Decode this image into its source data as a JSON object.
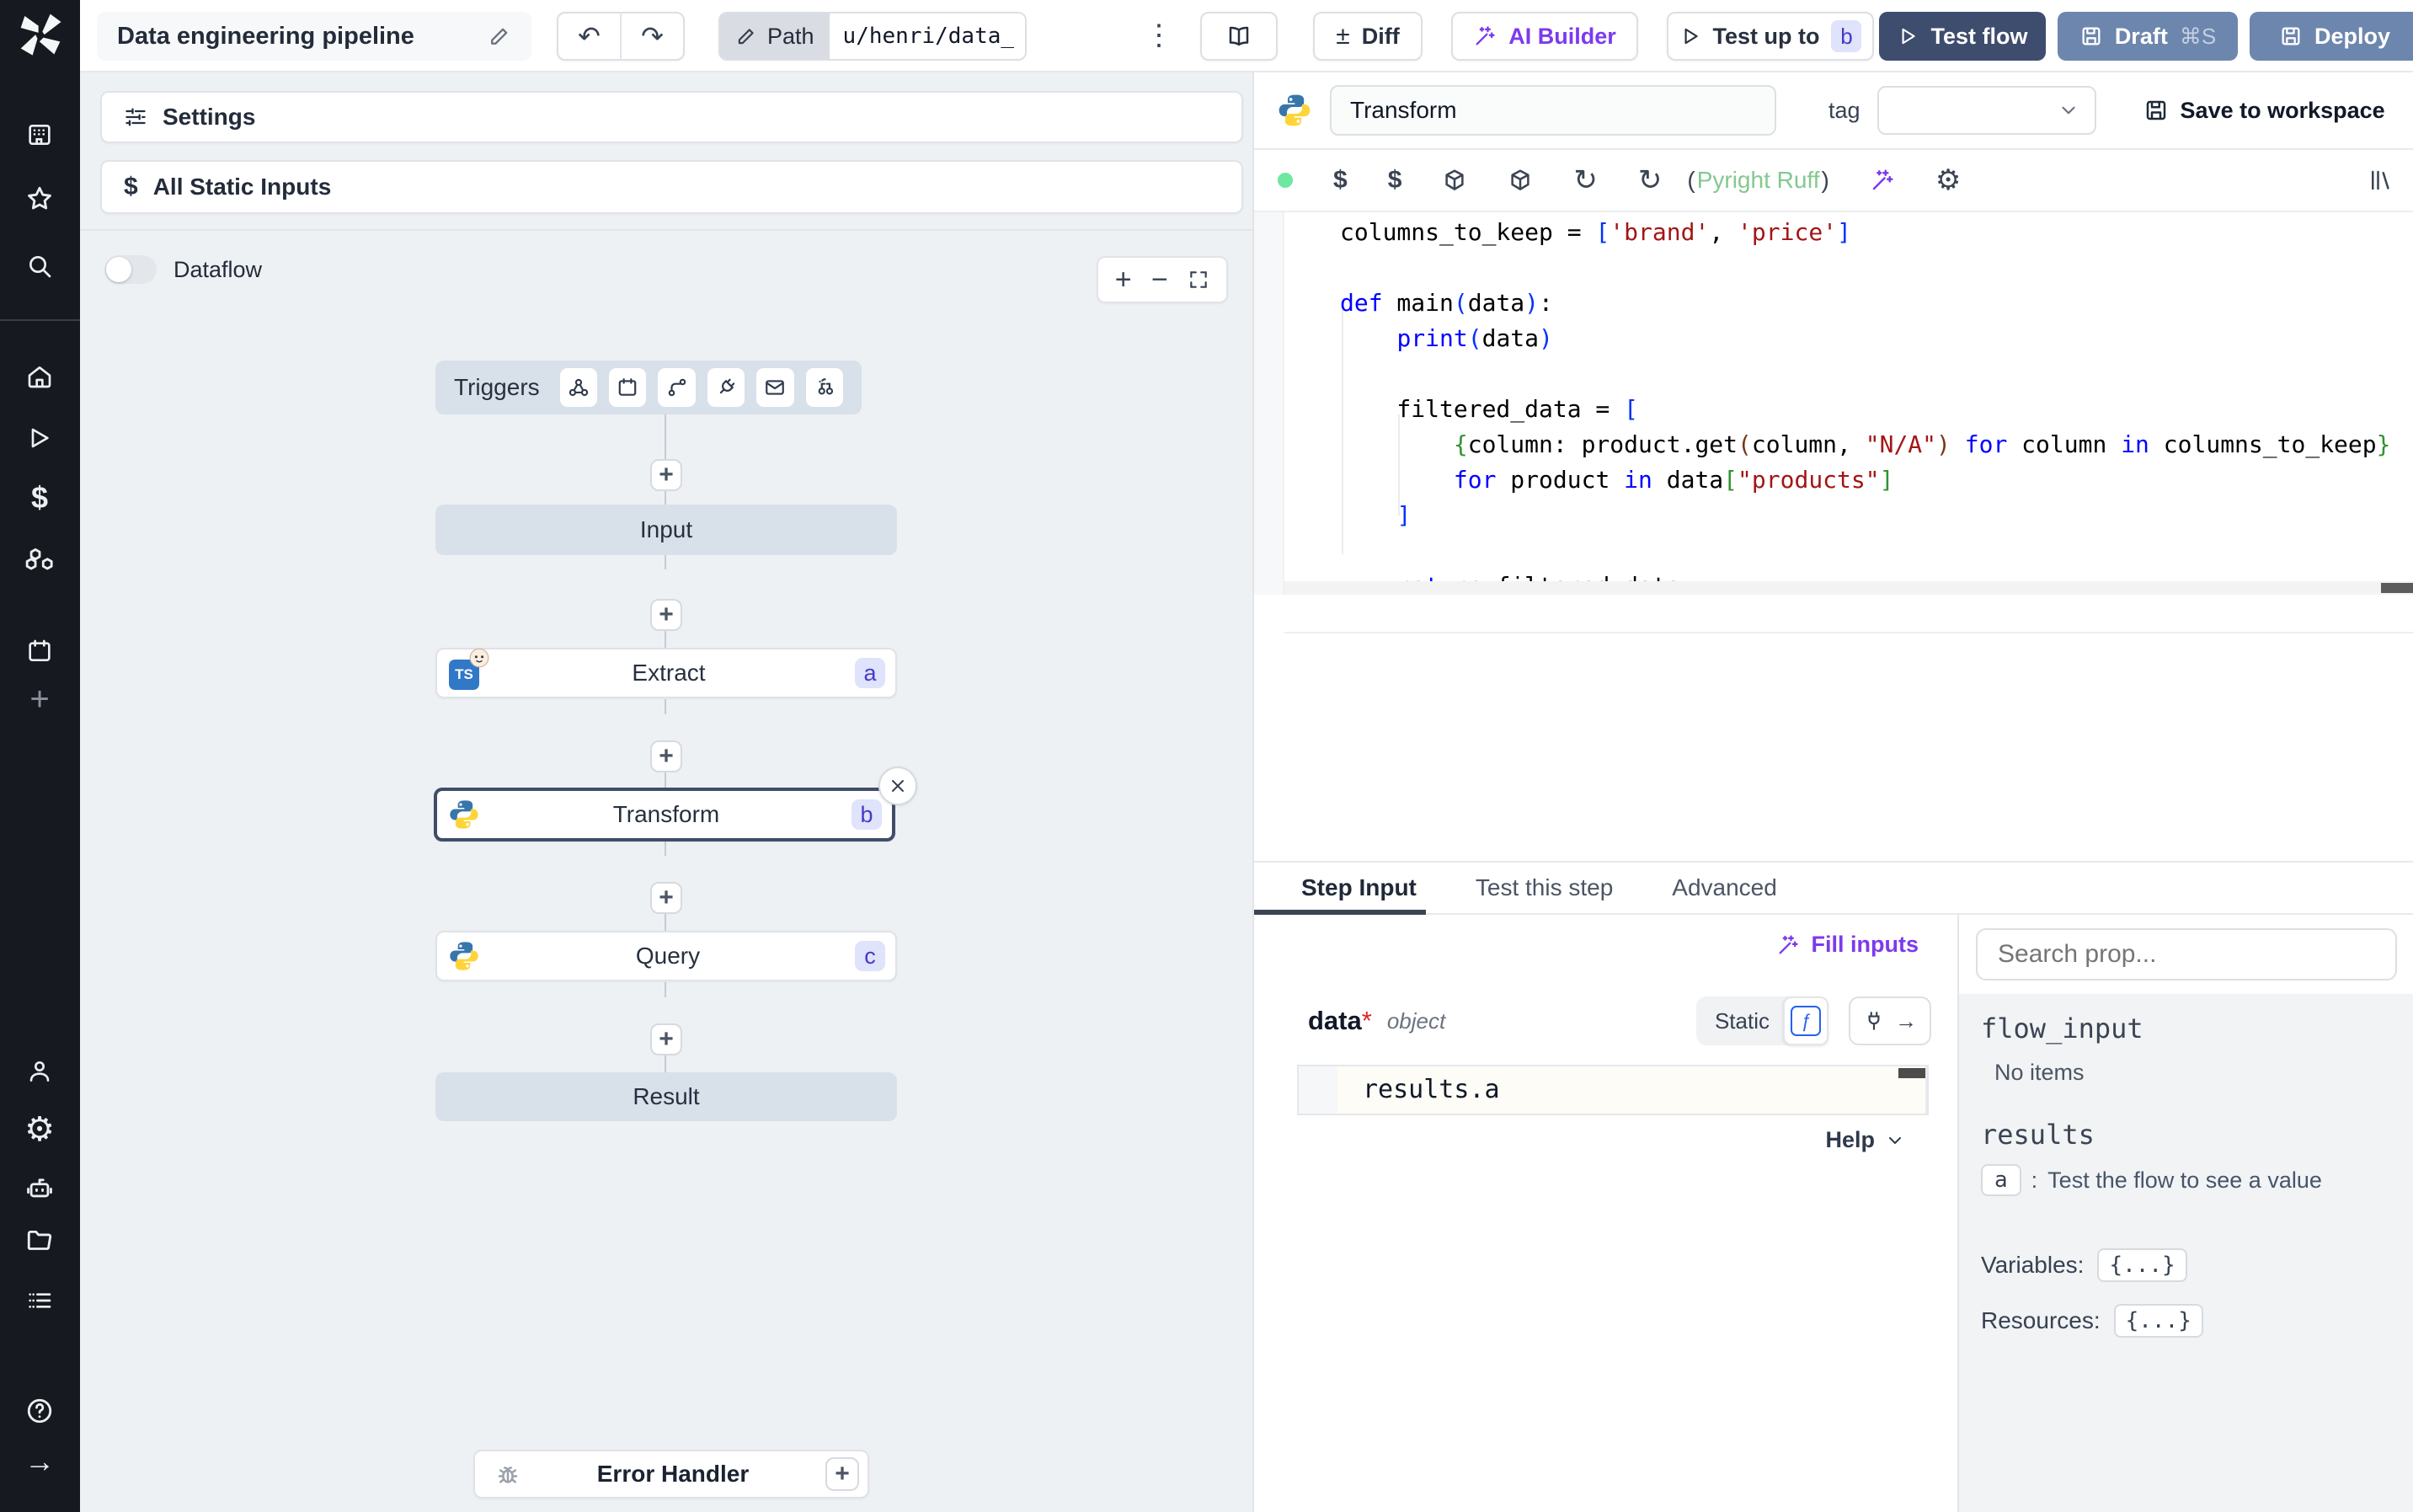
{
  "topbar": {
    "title": "Data engineering pipeline",
    "path_label": "Path",
    "path_value": "u/henri/data_",
    "diff_label": "Diff",
    "ai_builder_label": "AI Builder",
    "test_up_to_label": "Test up to",
    "test_up_to_badge": "b",
    "test_flow_label": "Test flow",
    "draft_label": "Draft",
    "draft_shortcut": "⌘S",
    "deploy_label": "Deploy"
  },
  "flow_panel": {
    "settings_label": "Settings",
    "static_inputs_label": "All Static Inputs",
    "dataflow_label": "Dataflow",
    "triggers_label": "Triggers",
    "nodes": {
      "input": {
        "label": "Input"
      },
      "extract": {
        "label": "Extract",
        "badge": "a",
        "lang": "TS"
      },
      "transform": {
        "label": "Transform",
        "badge": "b"
      },
      "query": {
        "label": "Query",
        "badge": "c"
      },
      "result": {
        "label": "Result"
      }
    },
    "error_handler_label": "Error Handler"
  },
  "editor": {
    "step_name": "Transform",
    "tag_label": "tag",
    "save_label": "Save to workspace",
    "diag_open": "(",
    "diag_text": "Pyright Ruff",
    "diag_close": ")",
    "code_lines": [
      [
        [
          "p",
          "columns_to_keep = "
        ],
        [
          "b",
          "["
        ],
        [
          "s",
          "'brand'"
        ],
        [
          "p",
          ", "
        ],
        [
          "s",
          "'price'"
        ],
        [
          "b",
          "]"
        ]
      ],
      [],
      [
        [
          "k",
          "def"
        ],
        [
          "p",
          " main"
        ],
        [
          "b",
          "("
        ],
        [
          "p",
          "data"
        ],
        [
          "b",
          ")"
        ],
        [
          "p",
          ":"
        ]
      ],
      [
        [
          "p",
          "    "
        ],
        [
          "k",
          "print"
        ],
        [
          "b",
          "("
        ],
        [
          "p",
          "data"
        ],
        [
          "b",
          ")"
        ]
      ],
      [],
      [
        [
          "p",
          "    filtered_data = "
        ],
        [
          "b",
          "["
        ]
      ],
      [
        [
          "p",
          "        "
        ],
        [
          "g",
          "{"
        ],
        [
          "p",
          "column: product.get"
        ],
        [
          "o",
          "("
        ],
        [
          "p",
          "column, "
        ],
        [
          "s",
          "\"N/A\""
        ],
        [
          "o",
          ")"
        ],
        [
          "p",
          " "
        ],
        [
          "k",
          "for"
        ],
        [
          "p",
          " column "
        ],
        [
          "k",
          "in"
        ],
        [
          "p",
          " columns_to_keep"
        ],
        [
          "g",
          "}"
        ]
      ],
      [
        [
          "p",
          "        "
        ],
        [
          "k",
          "for"
        ],
        [
          "p",
          " product "
        ],
        [
          "k",
          "in"
        ],
        [
          "p",
          " data"
        ],
        [
          "g",
          "["
        ],
        [
          "s",
          "\"products\""
        ],
        [
          "g",
          "]"
        ]
      ],
      [
        [
          "p",
          "    "
        ],
        [
          "b",
          "]"
        ]
      ],
      [],
      [
        [
          "p",
          "    "
        ],
        [
          "k",
          "return"
        ],
        [
          "p",
          " filtered_data"
        ]
      ]
    ]
  },
  "step_panel": {
    "tabs": {
      "step_input": "Step Input",
      "test_step": "Test this step",
      "advanced": "Advanced"
    },
    "fill_inputs_label": "Fill inputs",
    "arg_name": "data",
    "arg_required": "*",
    "arg_type": "object",
    "static_label": "Static",
    "expr_value": "results.a",
    "help_label": "Help"
  },
  "props_panel": {
    "search_placeholder": "Search prop...",
    "flow_input_label": "flow_input",
    "flow_input_empty": "No items",
    "results_label": "results",
    "result_key": "a",
    "result_sep": ":",
    "result_hint": "Test the flow to see a value",
    "variables_label": "Variables:",
    "variables_chip": "{...}",
    "resources_label": "Resources:",
    "resources_chip": "{...}"
  },
  "icons": {
    "undo": "↶",
    "redo": "↷",
    "kebab": "⋮",
    "plusminus": "±",
    "gear": "⚙",
    "arrow_right": "→",
    "help": "?",
    "dollar": "$",
    "fn": "ƒ",
    "plus": "+",
    "refresh": "↻"
  },
  "colors": {
    "rail_bg": "#16191f",
    "canvas_bg": "#eef1f4",
    "virtual_node": "#d8e0ea",
    "accent_purple": "#7c3aed",
    "test_flow_bg": "#3e4c6e",
    "deploy_bg": "#6d86ae",
    "badge_bg": "#dfe3fb",
    "badge_text": "#4838c9",
    "diag_green": "#84c88f",
    "status_dot": "#6ee7a0",
    "keyword_blue": "#0000ff",
    "string_red": "#a31515"
  }
}
